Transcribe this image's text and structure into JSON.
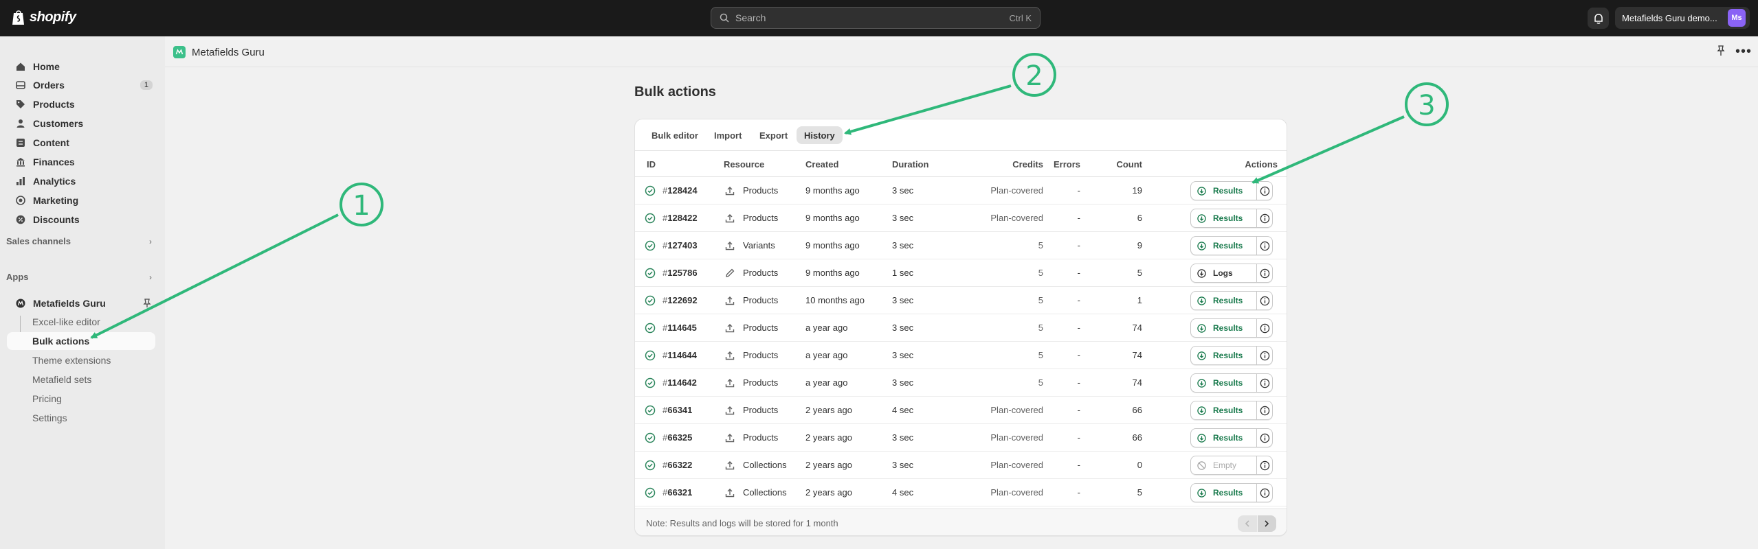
{
  "topbar": {
    "brand": "shopify",
    "search_placeholder": "Search",
    "search_shortcut": "Ctrl K",
    "store_name": "Metafields Guru demo...",
    "avatar_initials": "Ms"
  },
  "sidebar": {
    "items": [
      {
        "label": "Home",
        "icon": "home-icon"
      },
      {
        "label": "Orders",
        "icon": "orders-icon",
        "badge": "1"
      },
      {
        "label": "Products",
        "icon": "tag-icon"
      },
      {
        "label": "Customers",
        "icon": "person-icon"
      },
      {
        "label": "Content",
        "icon": "content-icon"
      },
      {
        "label": "Finances",
        "icon": "bank-icon"
      },
      {
        "label": "Analytics",
        "icon": "chart-icon"
      },
      {
        "label": "Marketing",
        "icon": "target-icon"
      },
      {
        "label": "Discounts",
        "icon": "discount-icon"
      }
    ],
    "sales_channels": "Sales channels",
    "apps": "Apps",
    "app_name": "Metafields Guru",
    "app_subitems": [
      "Excel-like editor",
      "Bulk actions",
      "Theme extensions",
      "Metafield sets",
      "Pricing",
      "Settings"
    ]
  },
  "app_header": {
    "title": "Metafields Guru",
    "more": "•••"
  },
  "main": {
    "title": "Bulk actions",
    "tabs": [
      "Bulk editor",
      "Import",
      "Export",
      "History"
    ],
    "columns": [
      "ID",
      "Resource",
      "Created",
      "Duration",
      "Credits",
      "Errors",
      "Count",
      "Actions"
    ],
    "rows": [
      {
        "id": "128424",
        "resource": "Products",
        "resource_icon": "upload-icon",
        "created": "9 months ago",
        "duration": "3 sec",
        "credits": "Plan-covered",
        "errors": "-",
        "count": "19",
        "action": "Results",
        "action_style": "green"
      },
      {
        "id": "128422",
        "resource": "Products",
        "resource_icon": "upload-icon",
        "created": "9 months ago",
        "duration": "3 sec",
        "credits": "Plan-covered",
        "errors": "-",
        "count": "6",
        "action": "Results",
        "action_style": "green"
      },
      {
        "id": "127403",
        "resource": "Variants",
        "resource_icon": "upload-icon",
        "created": "9 months ago",
        "duration": "3 sec",
        "credits": "5",
        "errors": "-",
        "count": "9",
        "action": "Results",
        "action_style": "green"
      },
      {
        "id": "125786",
        "resource": "Products",
        "resource_icon": "pencil-icon",
        "created": "9 months ago",
        "duration": "1 sec",
        "credits": "5",
        "errors": "-",
        "count": "5",
        "action": "Logs",
        "action_style": "dark"
      },
      {
        "id": "122692",
        "resource": "Products",
        "resource_icon": "upload-icon",
        "created": "10 months ago",
        "duration": "3 sec",
        "credits": "5",
        "errors": "-",
        "count": "1",
        "action": "Results",
        "action_style": "green"
      },
      {
        "id": "114645",
        "resource": "Products",
        "resource_icon": "upload-icon",
        "created": "a year ago",
        "duration": "3 sec",
        "credits": "5",
        "errors": "-",
        "count": "74",
        "action": "Results",
        "action_style": "green"
      },
      {
        "id": "114644",
        "resource": "Products",
        "resource_icon": "upload-icon",
        "created": "a year ago",
        "duration": "3 sec",
        "credits": "5",
        "errors": "-",
        "count": "74",
        "action": "Results",
        "action_style": "green"
      },
      {
        "id": "114642",
        "resource": "Products",
        "resource_icon": "upload-icon",
        "created": "a year ago",
        "duration": "3 sec",
        "credits": "5",
        "errors": "-",
        "count": "74",
        "action": "Results",
        "action_style": "green"
      },
      {
        "id": "66341",
        "resource": "Products",
        "resource_icon": "upload-icon",
        "created": "2 years ago",
        "duration": "4 sec",
        "credits": "Plan-covered",
        "errors": "-",
        "count": "66",
        "action": "Results",
        "action_style": "green"
      },
      {
        "id": "66325",
        "resource": "Products",
        "resource_icon": "upload-icon",
        "created": "2 years ago",
        "duration": "3 sec",
        "credits": "Plan-covered",
        "errors": "-",
        "count": "66",
        "action": "Results",
        "action_style": "green"
      },
      {
        "id": "66322",
        "resource": "Collections",
        "resource_icon": "upload-icon",
        "created": "2 years ago",
        "duration": "3 sec",
        "credits": "Plan-covered",
        "errors": "-",
        "count": "0",
        "action": "Empty",
        "action_style": "disabled"
      },
      {
        "id": "66321",
        "resource": "Collections",
        "resource_icon": "upload-icon",
        "created": "2 years ago",
        "duration": "4 sec",
        "credits": "Plan-covered",
        "errors": "-",
        "count": "5",
        "action": "Results",
        "action_style": "green"
      }
    ],
    "footer_note": "Note: Results and logs will be stored for 1 month"
  },
  "annotations": {
    "color": "#2fb87a",
    "labels": [
      "1",
      "2",
      "3"
    ]
  },
  "colors": {
    "topbar": "#1a1a1a",
    "accent_green": "#17794b",
    "success_icon": "#29845a",
    "avatar": "#8a63f5"
  }
}
